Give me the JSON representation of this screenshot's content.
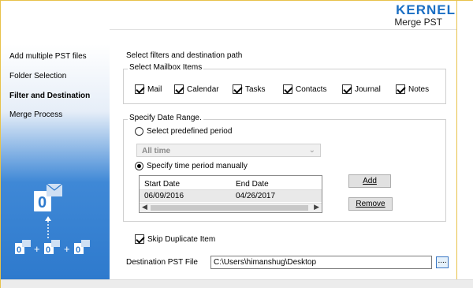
{
  "brand": {
    "name": "KERNEL",
    "product": "Merge PST"
  },
  "sidebar": {
    "items": [
      {
        "label": "Add multiple PST files",
        "active": false
      },
      {
        "label": "Folder Selection",
        "active": false
      },
      {
        "label": "Filter and Destination",
        "active": true
      },
      {
        "label": "Merge Process",
        "active": false
      }
    ],
    "illustration": {
      "main_icon": "outlook-icon",
      "small_icons": [
        "outlook-icon",
        "outlook-icon",
        "outlook-icon"
      ],
      "plus_sign": "+"
    }
  },
  "main": {
    "heading": "Select filters and destination path",
    "mailbox_group": {
      "legend": "Select Mailbox Items",
      "items": [
        {
          "label": "Mail",
          "checked": true
        },
        {
          "label": "Calendar",
          "checked": true
        },
        {
          "label": "Tasks",
          "checked": true
        },
        {
          "label": "Contacts",
          "checked": true
        },
        {
          "label": "Journal",
          "checked": true
        },
        {
          "label": "Notes",
          "checked": true
        }
      ]
    },
    "date_group": {
      "legend": "Specify Date Range.",
      "option_predefined": "Select predefined period",
      "predefined_value": "All time",
      "option_manual": "Specify time period manually",
      "selected_option": "manual",
      "table": {
        "columns": [
          "Start Date",
          "End Date"
        ],
        "rows": [
          {
            "start": "06/09/2016",
            "end": "04/26/2017"
          }
        ]
      },
      "add_button": "Add",
      "remove_button": "Remove"
    },
    "skip_duplicate": {
      "label": "Skip Duplicate Item",
      "checked": true
    },
    "destination": {
      "label": "Destination PST File",
      "value": "C:\\Users\\himanshug\\Desktop",
      "browse_label": "...."
    }
  },
  "colors": {
    "brand_blue": "#1b6fc4",
    "sidebar_blue": "#2e7acd",
    "window_border": "#e8c24a"
  }
}
